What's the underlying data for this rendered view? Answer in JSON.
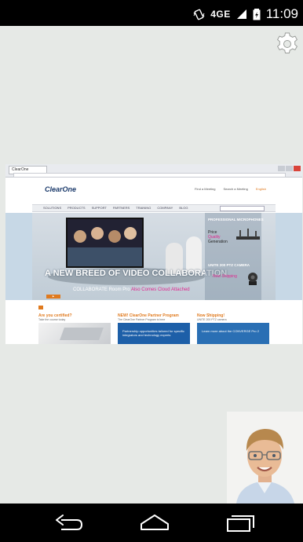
{
  "status_bar": {
    "network": "4GE",
    "time": "11:09"
  },
  "shared_screen": {
    "browser": {
      "tab_title": "ClearOne"
    },
    "website": {
      "logo": "ClearOne",
      "top_links": [
        "Find a Meeting",
        "Search a Meeting",
        "English"
      ],
      "nav_items": [
        "SOLUTIONS",
        "PRODUCTS",
        "SUPPORT",
        "PARTNERS",
        "TRAINING",
        "COMPANY",
        "BLOG"
      ],
      "hero_title": "A NEW BREED OF VIDEO COLLABORATION",
      "hero_product": "COLLABORATE",
      "hero_product_suffix": "Room Pro",
      "hero_tagline": "Also Comes Cloud Attached",
      "side_panel": {
        "title": "PROFESSIONAL MICROPHONES",
        "items": [
          "Price",
          "Quality",
          "Generation"
        ],
        "highlight_index": 1,
        "camera_title": "UNITE 200 PTZ CAMERA",
        "camera_link": "Now Shipping"
      },
      "cards": [
        {
          "title": "Are you certified?",
          "subtitle": "Take the course today",
          "caption": ""
        },
        {
          "title": "NEW! ClearOne Partner Program",
          "subtitle": "The ClearOne Partner Program is here",
          "caption": "Partnership opportunities tailored for specific integrators and technology experts"
        },
        {
          "title": "Now Shipping!",
          "subtitle": "UNITE 200 PTZ camera",
          "caption": "Learn more about the CONVERGE Pro 2"
        }
      ]
    }
  },
  "colors": {
    "status_bar": "#000000",
    "background": "#e6e9e6",
    "accent_orange": "#e07a1e",
    "accent_pink": "#e0268e",
    "clearone_blue": "#1b3a6b"
  },
  "icons": {
    "settings": "gear-icon",
    "back": "back-icon",
    "home": "home-icon",
    "recents": "recents-icon"
  }
}
